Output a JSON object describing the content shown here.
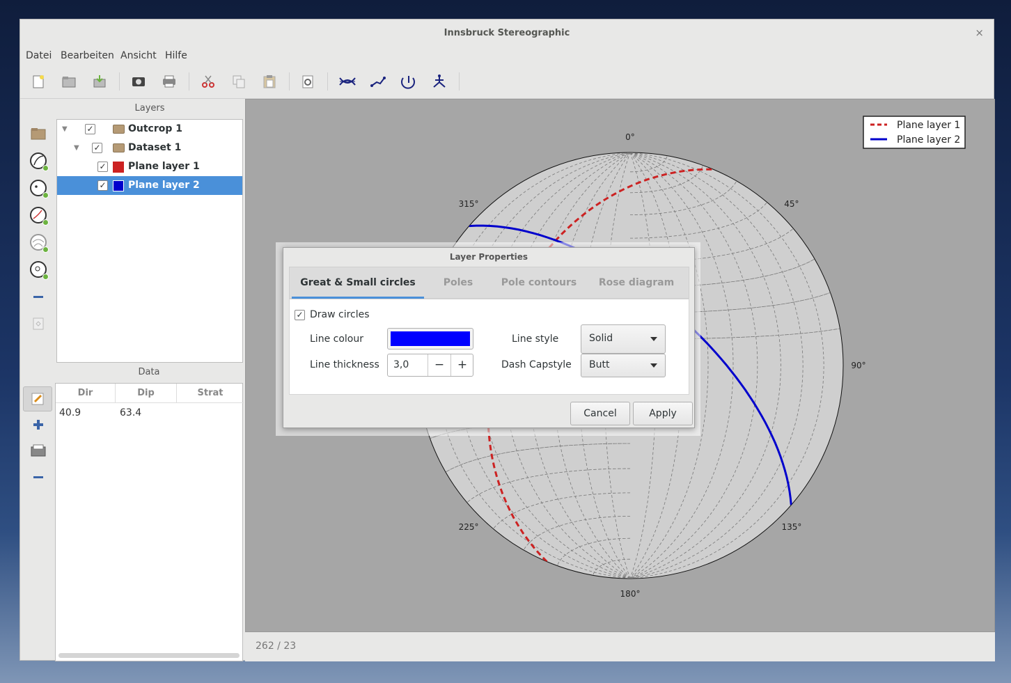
{
  "window": {
    "title": "Innsbruck Stereographic",
    "close_label": "×"
  },
  "menu": {
    "items": [
      "Datei",
      "Bearbeiten",
      "Ansicht",
      "Hilfe"
    ]
  },
  "toolbar": {
    "icons": [
      "new-file-icon",
      "open-file-icon",
      "save-file-icon",
      "screenshot-icon",
      "print-icon",
      "cut-icon",
      "copy-icon",
      "paste-icon",
      "settings-icon",
      "stereonet-icon",
      "line-tool-icon",
      "rotate-tool-icon",
      "fit-tool-icon"
    ]
  },
  "layers": {
    "title": "Layers",
    "items": [
      {
        "label": "Outcrop 1",
        "type": "folder",
        "checked": true,
        "selected": false
      },
      {
        "label": "Dataset 1",
        "type": "folder",
        "checked": true,
        "selected": false
      },
      {
        "label": "Plane layer 1",
        "type": "plane",
        "checked": true,
        "selected": false,
        "color": "#cc2222"
      },
      {
        "label": "Plane layer 2",
        "type": "plane",
        "checked": true,
        "selected": true,
        "color": "#0000cc"
      }
    ]
  },
  "data": {
    "title": "Data",
    "columns": [
      "Dir",
      "Dip",
      "Strat"
    ],
    "rows": [
      [
        "40.9",
        "63.4",
        ""
      ]
    ]
  },
  "plot": {
    "direction_labels": [
      "0°",
      "45°",
      "90°",
      "135°",
      "180°",
      "225°",
      "315°"
    ],
    "legend": [
      {
        "label": "Plane layer 1",
        "color": "#cc2222",
        "style": "dashed"
      },
      {
        "label": "Plane layer 2",
        "color": "#0000cc",
        "style": "solid"
      }
    ],
    "planes": [
      {
        "layer": "Plane layer 1",
        "dip_direction": 293,
        "dip": 38
      },
      {
        "layer": "Plane layer 2",
        "dip_direction": 40.9,
        "dip": 63.4
      }
    ],
    "grid": true
  },
  "status": {
    "text": "262 / 23"
  },
  "dialog": {
    "title": "Layer Properties",
    "tabs": [
      "Great & Small circles",
      "Poles",
      "Pole contours",
      "Rose diagram"
    ],
    "active_tab": "Great & Small circles",
    "draw_circles": {
      "label": "Draw circles",
      "checked": true
    },
    "line_colour": {
      "label": "Line colour",
      "value": "#0000ff"
    },
    "line_thickness": {
      "label": "Line thickness",
      "value": "3,0",
      "minus": "−",
      "plus": "+"
    },
    "line_style": {
      "label": "Line style",
      "value": "Solid"
    },
    "dash_capstyle": {
      "label": "Dash Capstyle",
      "value": "Butt"
    },
    "cancel_label": "Cancel",
    "apply_label": "Apply"
  }
}
